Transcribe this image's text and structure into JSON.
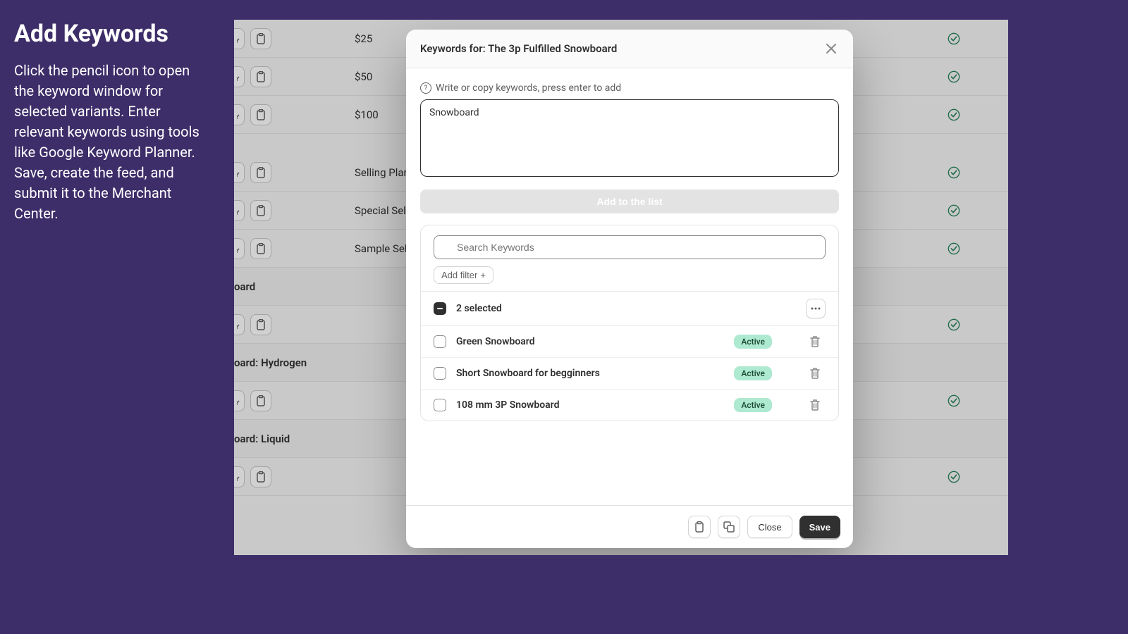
{
  "sidebar": {
    "title": "Add Keywords",
    "body": "Click the pencil icon to open the keyword window for selected variants. Enter relevant keywords using tools like Google Keyword Planner. Save, create the feed, and submit it to the Merchant Center."
  },
  "background_rows": [
    {
      "type": "item",
      "text": "$25"
    },
    {
      "type": "item",
      "text": "$50"
    },
    {
      "type": "item",
      "text": "$100"
    },
    {
      "type": "spacer"
    },
    {
      "type": "item",
      "text": "Selling Plans S"
    },
    {
      "type": "item",
      "text": "Special Selling"
    },
    {
      "type": "item",
      "text": "Sample Selling"
    },
    {
      "type": "group",
      "text": "oard"
    },
    {
      "type": "item",
      "text": ""
    },
    {
      "type": "group",
      "text": "oard: Hydrogen"
    },
    {
      "type": "item",
      "text": ""
    },
    {
      "type": "group",
      "text": "oard: Liquid"
    },
    {
      "type": "item",
      "text": ""
    }
  ],
  "modal": {
    "title": "Keywords for: The 3p Fulfilled Snowboard",
    "input_label": "Write or copy keywords, press enter to add",
    "textarea_value": "Snowboard",
    "add_button": "Add to the list",
    "search_placeholder": "Search Keywords",
    "add_filter": "Add filter",
    "selected_text": "2 selected",
    "keywords": [
      {
        "name": "Green Snowboard",
        "status": "Active"
      },
      {
        "name": "Short Snowboard for begginners",
        "status": "Active"
      },
      {
        "name": "108 mm 3P Snowboard",
        "status": "Active"
      }
    ],
    "footer": {
      "close": "Close",
      "save": "Save"
    }
  }
}
